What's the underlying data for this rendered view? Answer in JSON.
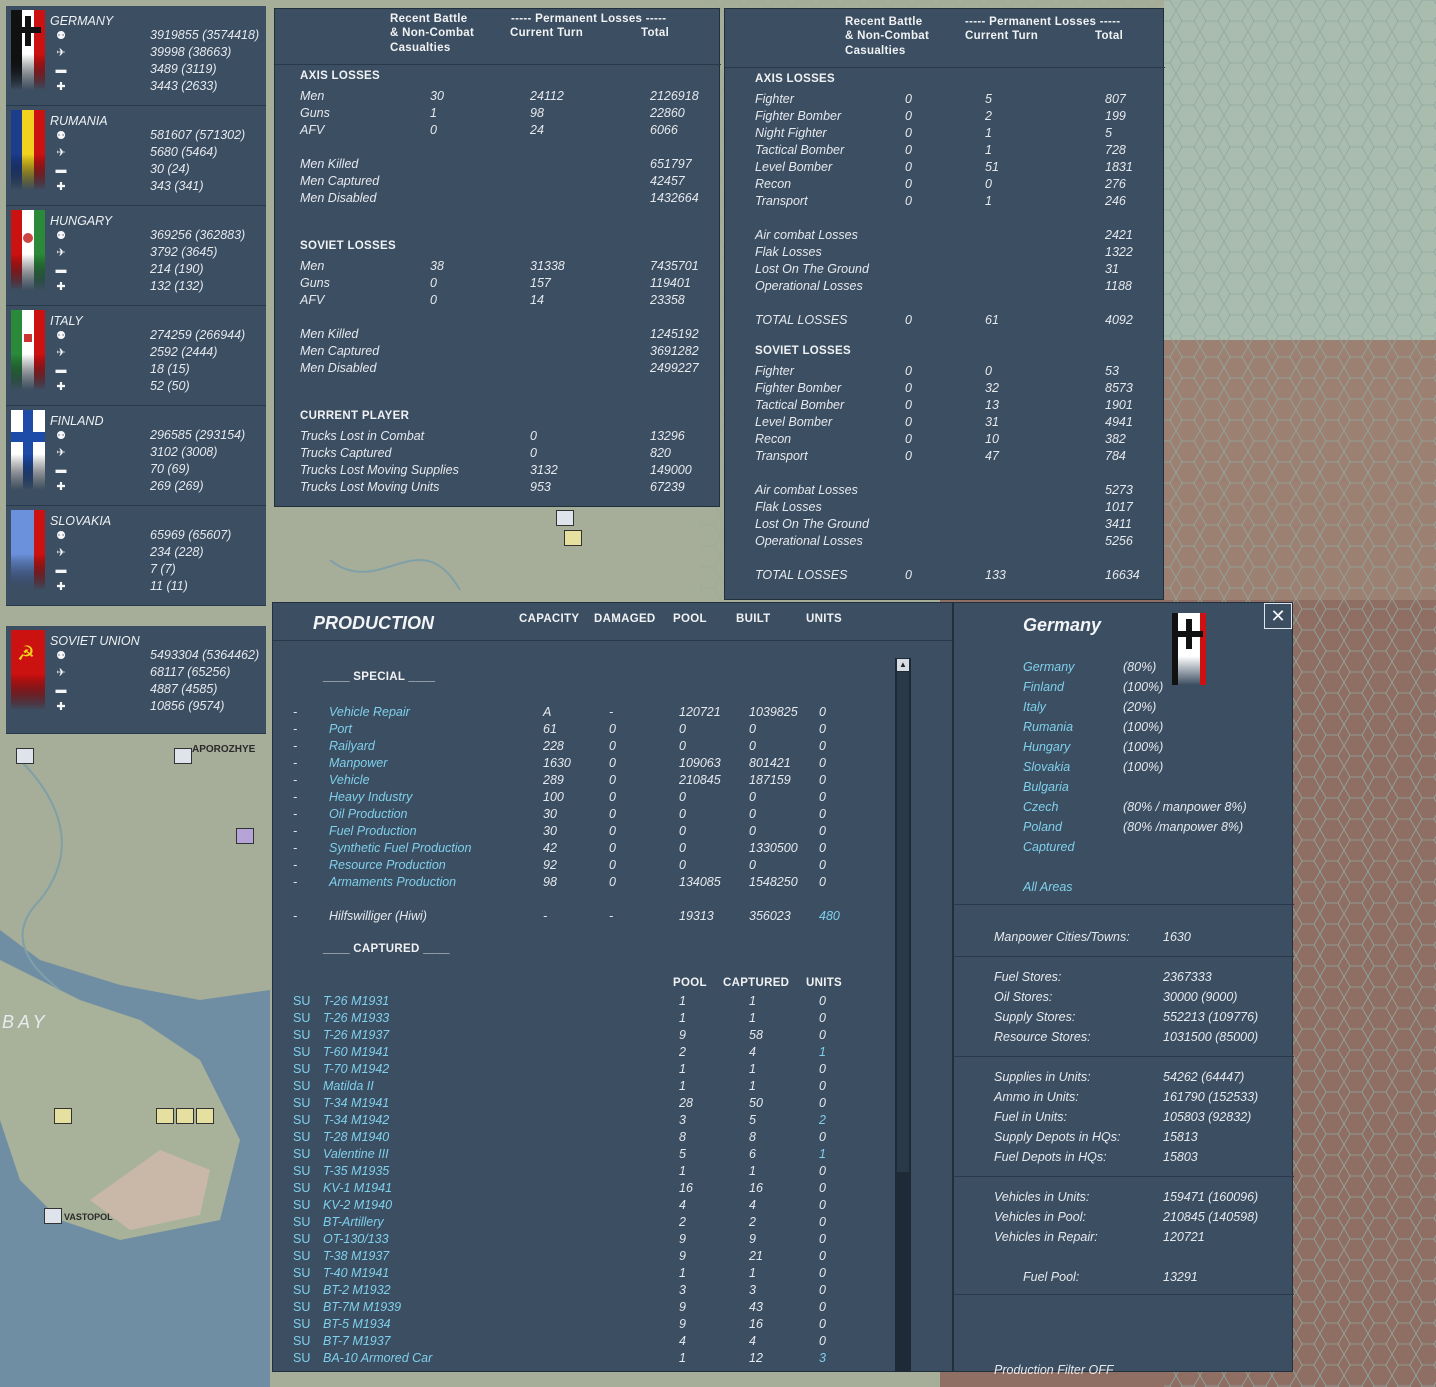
{
  "nations": [
    {
      "name": "GERMANY",
      "values": [
        "3919855 (3574418)",
        "39998 (38663)",
        "3489 (3119)",
        "3443 (2633)"
      ]
    },
    {
      "name": "RUMANIA",
      "values": [
        "581607 (571302)",
        "5680 (5464)",
        "30 (24)",
        "343 (341)"
      ]
    },
    {
      "name": "HUNGARY",
      "values": [
        "369256 (362883)",
        "3792 (3645)",
        "214 (190)",
        "132 (132)"
      ]
    },
    {
      "name": "ITALY",
      "values": [
        "274259 (266944)",
        "2592 (2444)",
        "18 (15)",
        "52 (50)"
      ]
    },
    {
      "name": "FINLAND",
      "values": [
        "296585 (293154)",
        "3102 (3008)",
        "70 (69)",
        "269 (269)"
      ]
    },
    {
      "name": "SLOVAKIA",
      "values": [
        "65969 (65607)",
        "234 (228)",
        "7 (7)",
        "11 (11)"
      ]
    },
    {
      "name": "SOVIET UNION",
      "values": [
        "5493304 (5364462)",
        "68117 (65256)",
        "4887 (4585)",
        "10856 (9574)"
      ]
    }
  ],
  "ground_losses": {
    "header": {
      "recent": "Recent Battle",
      "noncombat": "& Non-Combat",
      "casualties": "Casualties",
      "permanent": "----- Permanent Losses -----",
      "current_turn": "Current Turn",
      "total": "Total"
    },
    "axis_title": "AXIS LOSSES",
    "axis_rows": [
      [
        "Men",
        "30",
        "24112",
        "2126918"
      ],
      [
        "Guns",
        "1",
        "98",
        "22860"
      ],
      [
        "AFV",
        "0",
        "24",
        "6066"
      ]
    ],
    "axis_detail": [
      [
        "Men Killed",
        "651797"
      ],
      [
        "Men Captured",
        "42457"
      ],
      [
        "Men Disabled",
        "1432664"
      ]
    ],
    "soviet_title": "SOVIET LOSSES",
    "soviet_rows": [
      [
        "Men",
        "38",
        "31338",
        "7435701"
      ],
      [
        "Guns",
        "0",
        "157",
        "119401"
      ],
      [
        "AFV",
        "0",
        "14",
        "23358"
      ]
    ],
    "soviet_detail": [
      [
        "Men Killed",
        "1245192"
      ],
      [
        "Men Captured",
        "3691282"
      ],
      [
        "Men Disabled",
        "2499227"
      ]
    ],
    "player_title": "CURRENT PLAYER",
    "player_rows": [
      [
        "Trucks Lost in Combat",
        "0",
        "13296"
      ],
      [
        "Trucks Captured",
        "0",
        "820"
      ],
      [
        "Trucks Lost Moving Supplies",
        "3132",
        "149000"
      ],
      [
        "Trucks Lost Moving Units",
        "953",
        "67239"
      ]
    ]
  },
  "air_losses": {
    "header": {
      "recent": "Recent Battle",
      "noncombat": "& Non-Combat",
      "casualties": "Casualties",
      "permanent": "----- Permanent Losses -----",
      "current_turn": "Current Turn",
      "total": "Total"
    },
    "axis_title": "AXIS LOSSES",
    "axis_rows": [
      [
        "Fighter",
        "0",
        "5",
        "807"
      ],
      [
        "Fighter Bomber",
        "0",
        "2",
        "199"
      ],
      [
        "Night Fighter",
        "0",
        "1",
        "5"
      ],
      [
        "Tactical Bomber",
        "0",
        "1",
        "728"
      ],
      [
        "Level Bomber",
        "0",
        "51",
        "1831"
      ],
      [
        "Recon",
        "0",
        "0",
        "276"
      ],
      [
        "Transport",
        "0",
        "1",
        "246"
      ]
    ],
    "axis_other": [
      [
        "Air combat Losses",
        "2421"
      ],
      [
        "Flak Losses",
        "1322"
      ],
      [
        "Lost On The Ground",
        "31"
      ],
      [
        "Operational Losses",
        "1188"
      ]
    ],
    "axis_total": [
      "TOTAL LOSSES",
      "0",
      "61",
      "4092"
    ],
    "soviet_title": "SOVIET LOSSES",
    "soviet_rows": [
      [
        "Fighter",
        "0",
        "0",
        "53"
      ],
      [
        "Fighter Bomber",
        "0",
        "32",
        "8573"
      ],
      [
        "Tactical Bomber",
        "0",
        "13",
        "1901"
      ],
      [
        "Level Bomber",
        "0",
        "31",
        "4941"
      ],
      [
        "Recon",
        "0",
        "10",
        "382"
      ],
      [
        "Transport",
        "0",
        "47",
        "784"
      ]
    ],
    "soviet_other": [
      [
        "Air combat Losses",
        "5273"
      ],
      [
        "Flak Losses",
        "1017"
      ],
      [
        "Lost On The Ground",
        "3411"
      ],
      [
        "Operational Losses",
        "5256"
      ]
    ],
    "soviet_total": [
      "TOTAL LOSSES",
      "0",
      "133",
      "16634"
    ]
  },
  "production": {
    "title": "PRODUCTION",
    "cols": [
      "CAPACITY",
      "DAMAGED",
      "POOL",
      "BUILT",
      "UNITS"
    ],
    "special_title": "____ SPECIAL ____",
    "special": [
      [
        "-",
        "Vehicle Repair",
        "A",
        "-",
        "120721",
        "1039825",
        "0"
      ],
      [
        "-",
        "Port",
        "61",
        "0",
        "0",
        "0",
        "0"
      ],
      [
        "-",
        "Railyard",
        "228",
        "0",
        "0",
        "0",
        "0"
      ],
      [
        "-",
        "Manpower",
        "1630",
        "0",
        "109063",
        "801421",
        "0"
      ],
      [
        "-",
        "Vehicle",
        "289",
        "0",
        "210845",
        "187159",
        "0"
      ],
      [
        "-",
        "Heavy Industry",
        "100",
        "0",
        "0",
        "0",
        "0"
      ],
      [
        "-",
        "Oil Production",
        "30",
        "0",
        "0",
        "0",
        "0"
      ],
      [
        "-",
        "Fuel Production",
        "30",
        "0",
        "0",
        "0",
        "0"
      ],
      [
        "-",
        "Synthetic Fuel Production",
        "42",
        "0",
        "0",
        "1330500",
        "0"
      ],
      [
        "-",
        "Resource Production",
        "92",
        "0",
        "0",
        "0",
        "0"
      ],
      [
        "-",
        "Armaments Production",
        "98",
        "0",
        "134085",
        "1548250",
        "0"
      ]
    ],
    "hiwi": [
      "-",
      "Hilfswilliger (Hiwi)",
      "-",
      "-",
      "19313",
      "356023",
      "480"
    ],
    "captured_title": "____ CAPTURED ____",
    "captured_cols": [
      "POOL",
      "CAPTURED",
      "UNITS"
    ],
    "captured": [
      [
        "SU",
        "T-26 M1931",
        "1",
        "1",
        "0"
      ],
      [
        "SU",
        "T-26 M1933",
        "1",
        "1",
        "0"
      ],
      [
        "SU",
        "T-26 M1937",
        "9",
        "58",
        "0"
      ],
      [
        "SU",
        "T-60 M1941",
        "2",
        "4",
        "1"
      ],
      [
        "SU",
        "T-70 M1942",
        "1",
        "1",
        "0"
      ],
      [
        "SU",
        "Matilda II",
        "1",
        "1",
        "0"
      ],
      [
        "SU",
        "T-34 M1941",
        "28",
        "50",
        "0"
      ],
      [
        "SU",
        "T-34 M1942",
        "3",
        "5",
        "2"
      ],
      [
        "SU",
        "T-28 M1940",
        "8",
        "8",
        "0"
      ],
      [
        "SU",
        "Valentine III",
        "5",
        "6",
        "1"
      ],
      [
        "SU",
        "T-35 M1935",
        "1",
        "1",
        "0"
      ],
      [
        "SU",
        "KV-1 M1941",
        "16",
        "16",
        "0"
      ],
      [
        "SU",
        "KV-2 M1940",
        "4",
        "4",
        "0"
      ],
      [
        "SU",
        "BT-Artillery",
        "2",
        "2",
        "0"
      ],
      [
        "SU",
        "OT-130/133",
        "9",
        "9",
        "0"
      ],
      [
        "SU",
        "T-38 M1937",
        "9",
        "21",
        "0"
      ],
      [
        "SU",
        "T-40 M1941",
        "1",
        "1",
        "0"
      ],
      [
        "SU",
        "BT-2 M1932",
        "3",
        "3",
        "0"
      ],
      [
        "SU",
        "BT-7M M1939",
        "9",
        "43",
        "0"
      ],
      [
        "SU",
        "BT-5 M1934",
        "9",
        "16",
        "0"
      ],
      [
        "SU",
        "BT-7 M1937",
        "4",
        "4",
        "0"
      ],
      [
        "SU",
        "BA-10 Armored Car",
        "1",
        "12",
        "3"
      ]
    ]
  },
  "side": {
    "title": "Germany",
    "areas": [
      [
        "Germany",
        "(80%)"
      ],
      [
        "Finland",
        "(100%)"
      ],
      [
        "Italy",
        "(20%)"
      ],
      [
        "Rumania",
        "(100%)"
      ],
      [
        "Hungary",
        "(100%)"
      ],
      [
        "Slovakia",
        "(100%)"
      ],
      [
        "Bulgaria",
        ""
      ],
      [
        "Czech",
        "(80% / manpower 8%)"
      ],
      [
        "Poland",
        "(80% /manpower 8%)"
      ],
      [
        "Captured",
        ""
      ]
    ],
    "all_areas": "All Areas",
    "manpower": [
      "Manpower Cities/Towns:",
      "1630"
    ],
    "stores": [
      [
        "Fuel Stores:",
        "2367333"
      ],
      [
        "Oil Stores:",
        "30000 (9000)"
      ],
      [
        "Supply Stores:",
        "552213 (109776)"
      ],
      [
        "Resource Stores:",
        "1031500 (85000)"
      ]
    ],
    "units": [
      [
        "Supplies in Units:",
        "54262 (64447)"
      ],
      [
        "Ammo in Units:",
        "161790 (152533)"
      ],
      [
        "Fuel in Units:",
        "105803 (92832)"
      ],
      [
        "Supply Depots in HQs:",
        "15813"
      ],
      [
        "Fuel Depots in HQs:",
        "15803"
      ]
    ],
    "vehicles": [
      [
        "Vehicles in Units:",
        "159471 (160096)"
      ],
      [
        "Vehicles in Pool:",
        "210845 (140598)"
      ],
      [
        "Vehicles in Repair:",
        "120721"
      ]
    ],
    "fuel_pool": [
      "Fuel Pool:",
      "13291"
    ],
    "filter": "Production Filter OFF",
    "close": "✕"
  },
  "map": {
    "labels": [
      "APOROZHYE",
      "VASTOPOL",
      "BAY"
    ]
  },
  "colors": {
    "panel": "#3c4e61",
    "link": "#7fd0ec",
    "map_land": "#a9b49a",
    "map_hex": "#9a7f6f",
    "sea": "#6f8fa4"
  }
}
